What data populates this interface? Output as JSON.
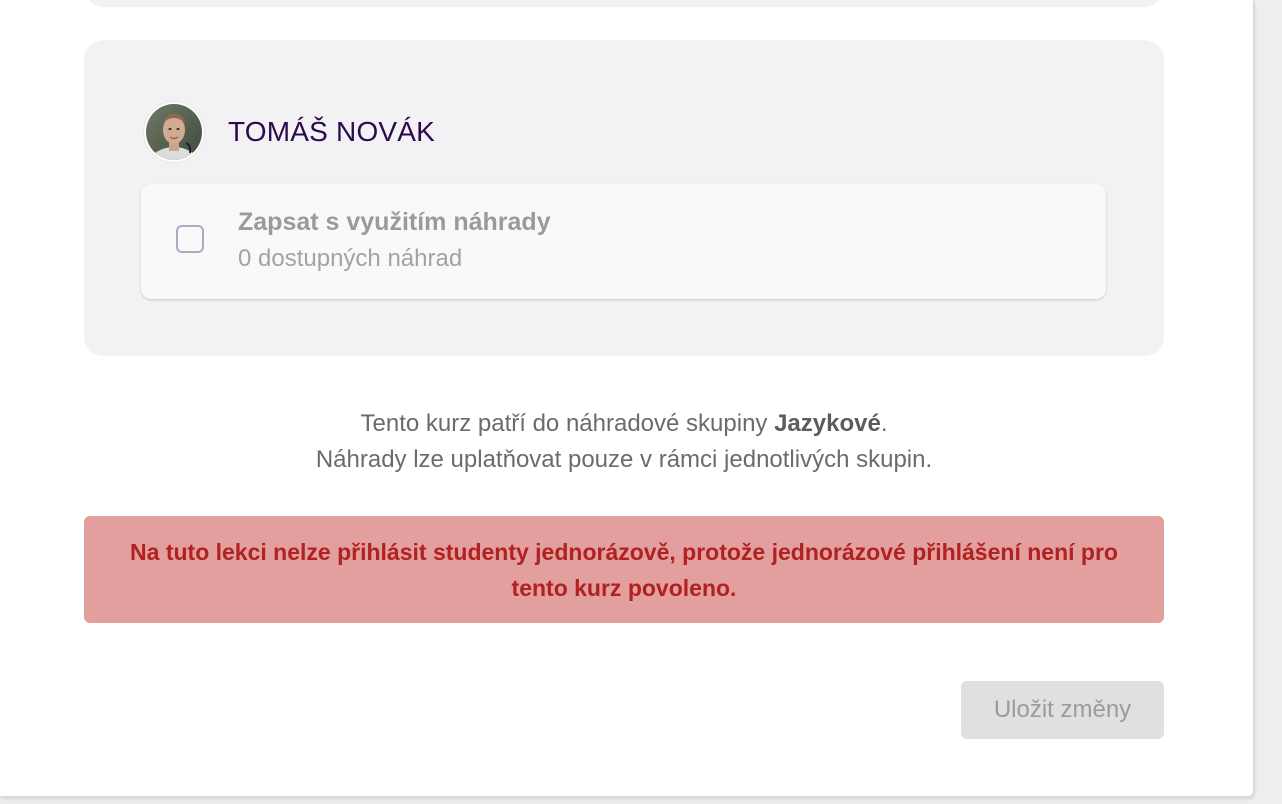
{
  "student": {
    "name": "TOMÁŠ NOVÁK",
    "avatar_icon": "person-photo"
  },
  "replacement_option": {
    "title": "Zapsat s využitím náhrady",
    "subtitle": "0 dostupných náhrad",
    "checked": false
  },
  "info": {
    "line1_prefix": "Tento kurz patří do náhradové skupiny ",
    "group_name": "Jazykové",
    "line1_suffix": ".",
    "line2": "Náhrady lze uplatňovat pouze v rámci jednotlivých skupin."
  },
  "alert": {
    "message": "Na tuto lekci nelze přihlásit studenty jednorázově, protože jednorázové přihlášení není pro tento kurz povoleno."
  },
  "actions": {
    "save_label": "Uložit změny",
    "save_disabled": true
  },
  "colors": {
    "card_bg": "#f2f2f4",
    "name_color": "#2d0a4e",
    "alert_bg": "#e39e9e",
    "alert_text": "#b02121",
    "checkbox_border": "#b3a7c7"
  }
}
